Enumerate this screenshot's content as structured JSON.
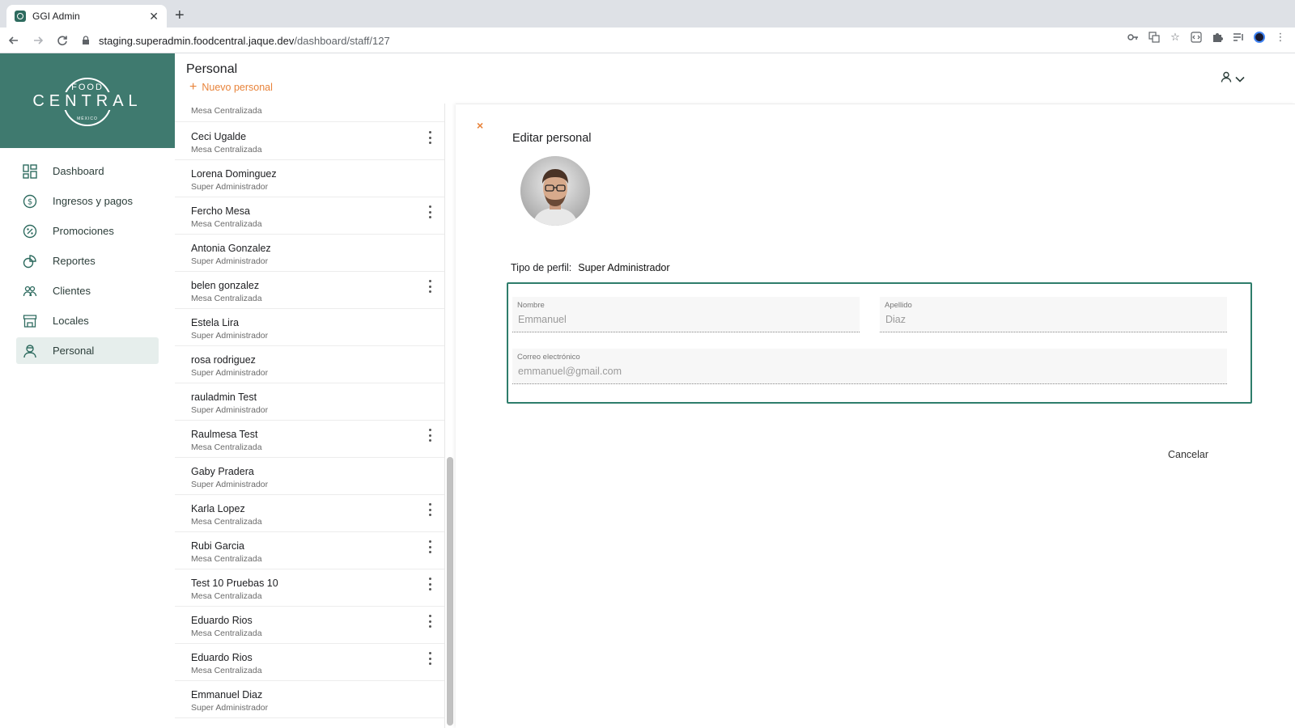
{
  "browser": {
    "tab_title": "GGI Admin",
    "url_host": "staging.superadmin.foodcentral.jaque.dev",
    "url_path": "/dashboard/staff/127"
  },
  "logo": {
    "top": "FOOD",
    "main": "CENTRAL",
    "sub": "MÉXICO"
  },
  "sidebar": {
    "items": [
      {
        "label": "Dashboard",
        "icon": "dashboard-icon"
      },
      {
        "label": "Ingresos y pagos",
        "icon": "dollar-icon"
      },
      {
        "label": "Promociones",
        "icon": "percent-icon"
      },
      {
        "label": "Reportes",
        "icon": "reports-icon"
      },
      {
        "label": "Clientes",
        "icon": "clients-icon"
      },
      {
        "label": "Locales",
        "icon": "store-icon"
      },
      {
        "label": "Personal",
        "icon": "staff-icon"
      }
    ]
  },
  "header": {
    "title": "Personal",
    "new_label": "Nuevo personal"
  },
  "staff_list": {
    "top_role": "Mesa Centralizada",
    "items": [
      {
        "name": "Ceci Ugalde",
        "role": "Mesa Centralizada",
        "menu": true
      },
      {
        "name": "Lorena Dominguez",
        "role": "Super Administrador",
        "menu": false
      },
      {
        "name": "Fercho Mesa",
        "role": "Mesa Centralizada",
        "menu": true
      },
      {
        "name": "Antonia Gonzalez",
        "role": "Super Administrador",
        "menu": false
      },
      {
        "name": "belen gonzalez",
        "role": "Mesa Centralizada",
        "menu": true
      },
      {
        "name": "Estela Lira",
        "role": "Super Administrador",
        "menu": false
      },
      {
        "name": "rosa rodriguez",
        "role": "Super Administrador",
        "menu": false
      },
      {
        "name": "rauladmin Test",
        "role": "Super Administrador",
        "menu": false
      },
      {
        "name": "Raulmesa Test",
        "role": "Mesa Centralizada",
        "menu": true
      },
      {
        "name": "Gaby Pradera",
        "role": "Super Administrador",
        "menu": false
      },
      {
        "name": "Karla Lopez",
        "role": "Mesa Centralizada",
        "menu": true
      },
      {
        "name": "Rubi Garcia",
        "role": "Mesa Centralizada",
        "menu": true
      },
      {
        "name": "Test 10 Pruebas 10",
        "role": "Mesa Centralizada",
        "menu": true
      },
      {
        "name": "Eduardo Rios",
        "role": "Mesa Centralizada",
        "menu": true
      },
      {
        "name": "Eduardo Rios",
        "role": "Mesa Centralizada",
        "menu": true
      },
      {
        "name": "Emmanuel Diaz",
        "role": "Super Administrador",
        "menu": false
      }
    ]
  },
  "detail": {
    "close": "×",
    "title": "Editar personal",
    "profile_type_label": "Tipo de perfil:",
    "profile_type_value": "Super Administrador",
    "first_name_label": "Nombre",
    "first_name_value": "Emmanuel",
    "last_name_label": "Apellido",
    "last_name_value": "Diaz",
    "email_label": "Correo electrónico",
    "email_value": "emmanuel@gmail.com",
    "cancel_label": "Cancelar"
  }
}
